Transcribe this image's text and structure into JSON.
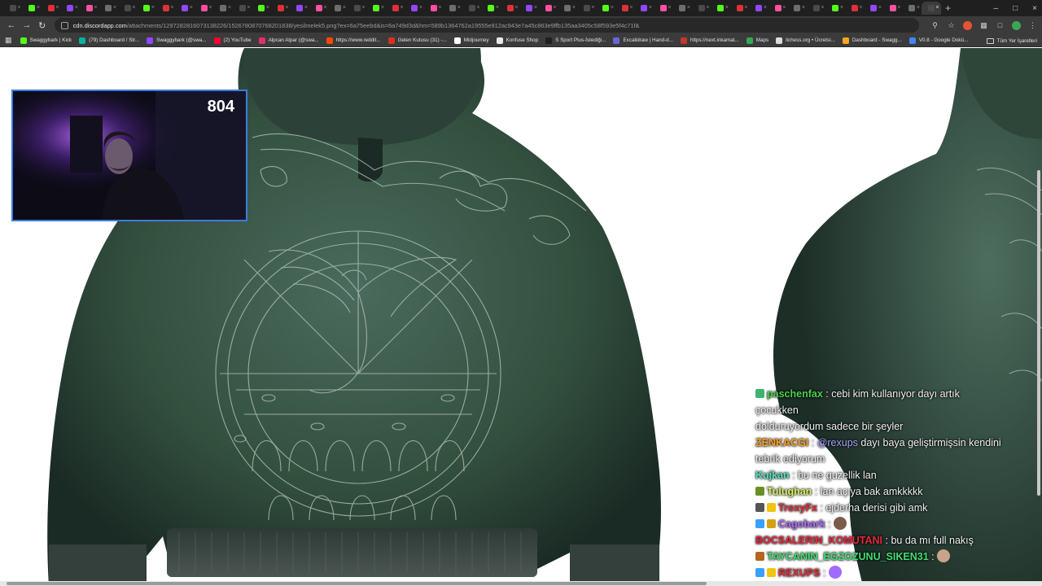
{
  "browser": {
    "tab_count": 49,
    "url": {
      "host": "cdn.discordapp.com",
      "path": "/attachments/1297282816073138226/1526780870768201838/yesilmelek5.png?ex=6a75eebd&is=6a749d3d&hm=589b1364762a19555e912ac943e7a45c863e9ffb135aa3405c58f593e5f4c71f&"
    },
    "bookmarks": [
      {
        "label": "Swaggybark | Kick",
        "color": "#53fc18"
      },
      {
        "label": "(79) Dashboard / Str...",
        "color": "#00b3a1"
      },
      {
        "label": "Swaggybark (@swa...",
        "color": "#9146ff"
      },
      {
        "label": "(2) YouTube",
        "color": "#ff0033"
      },
      {
        "label": "Alpcan Alpar (@swa...",
        "color": "#e1306c"
      },
      {
        "label": "https://www.reddit...",
        "color": "#ff4500"
      },
      {
        "label": "Gelen Kutusu (31) -...",
        "color": "#d93025"
      },
      {
        "label": "Midjourney",
        "color": "#ffffff"
      },
      {
        "label": "Konfuse Shop",
        "color": "#e8e8e8"
      },
      {
        "label": "S Sport Plus-İstediği...",
        "color": "#1f1f1f"
      },
      {
        "label": "Excalidraw | Hand-d...",
        "color": "#6965db"
      },
      {
        "label": "https://next.inkamat...",
        "color": "#c0392b"
      },
      {
        "label": "Maps",
        "color": "#34a853"
      },
      {
        "label": "lichess.org • Ücretsi...",
        "color": "#dddddd"
      },
      {
        "label": "Dashboard - Swagg...",
        "color": "#f5a623"
      },
      {
        "label": "V0.8 - Google Dokü...",
        "color": "#4285f4"
      }
    ],
    "all_bookmarks_label": "Tüm Yer İşaretleri"
  },
  "stream": {
    "viewer_count": "804"
  },
  "chat": {
    "messages": [
      {
        "user": "paschenfax",
        "user_color": "#4dd24d",
        "badges": [
          "#3cb371"
        ],
        "text": "cebi kim kullanıyor dayı artık çocukken"
      },
      {
        "user": "",
        "user_color": "#ffffff",
        "badges": [],
        "text": "dolduruyordum sadece bir şeyler"
      },
      {
        "user": "ZENKACGI",
        "user_color": "#ff9f1a",
        "badges": [],
        "mention": "@rexups",
        "text": "dayı baya geliştirmişsin kendini"
      },
      {
        "user": "",
        "user_color": "#ffffff",
        "badges": [],
        "text": "tebrik ediyorum"
      },
      {
        "user": "Kujkan",
        "user_color": "#4fe3c1",
        "badges": [],
        "text": "bu ne guzellik lan"
      },
      {
        "user": "Tulughan",
        "user_color": "#d9f25a",
        "badges": [
          "#6b8e23"
        ],
        "text": "lan açıya bak amkkkkk"
      },
      {
        "user": "TroxyFx",
        "user_color": "#e0303a",
        "badges": [
          "#555555",
          "#f1c40f"
        ],
        "text": "ejderha derisi gibi amk"
      },
      {
        "user": "Cagobark",
        "user_color": "#b06cff",
        "badges": [
          "#3aa0ff",
          "#d4a017"
        ],
        "text": "",
        "emote": "#7a5a48"
      },
      {
        "user": "BOCSALERIN_KOMUTANI",
        "user_color": "#e8283e",
        "badges": [],
        "text": "bu da mı full nakış"
      },
      {
        "user": "TAYCANIN_EGZOZUNU_SIKEN31",
        "user_color": "#3fe070",
        "badges": [
          "#b5651d"
        ],
        "text": "",
        "emote": "#c8a48a"
      },
      {
        "user": "REXUPS",
        "user_color": "#e0303a",
        "badges": [
          "#3aa0ff",
          "#f1c40f"
        ],
        "text": "",
        "emote": "#a26bff"
      }
    ]
  },
  "colors": {
    "hoodie": "#3a5a4c",
    "hoodie_dark": "#1e2f29",
    "embroidery": "#b9c9bf",
    "webcam_border": "#3d7ce0"
  }
}
